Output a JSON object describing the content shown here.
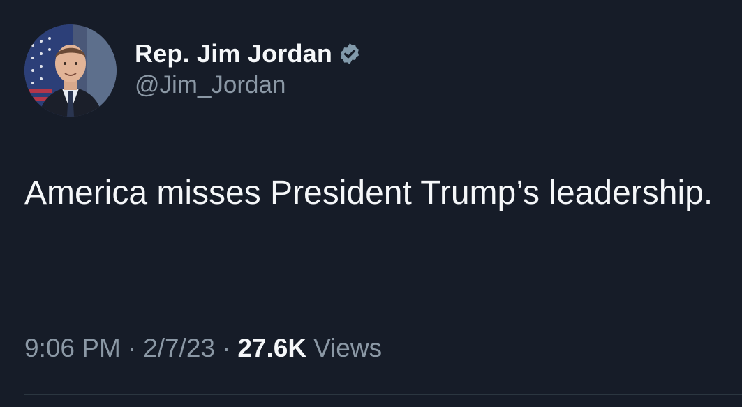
{
  "author": {
    "display_name": "Rep. Jim Jordan",
    "handle": "@Jim_Jordan",
    "verified_badge_color": "#829aab",
    "verified_icon": "verified-badge-icon"
  },
  "tweet": {
    "text": "America misses President Trump’s leadership."
  },
  "meta": {
    "time": "9:06 PM",
    "separator": "·",
    "date": "2/7/23",
    "views_count": "27.6K",
    "views_label": "Views"
  },
  "colors": {
    "background": "#161c28",
    "primary_text": "#f5f7f9",
    "secondary_text": "#8b98a5",
    "divider": "#2b3640"
  }
}
